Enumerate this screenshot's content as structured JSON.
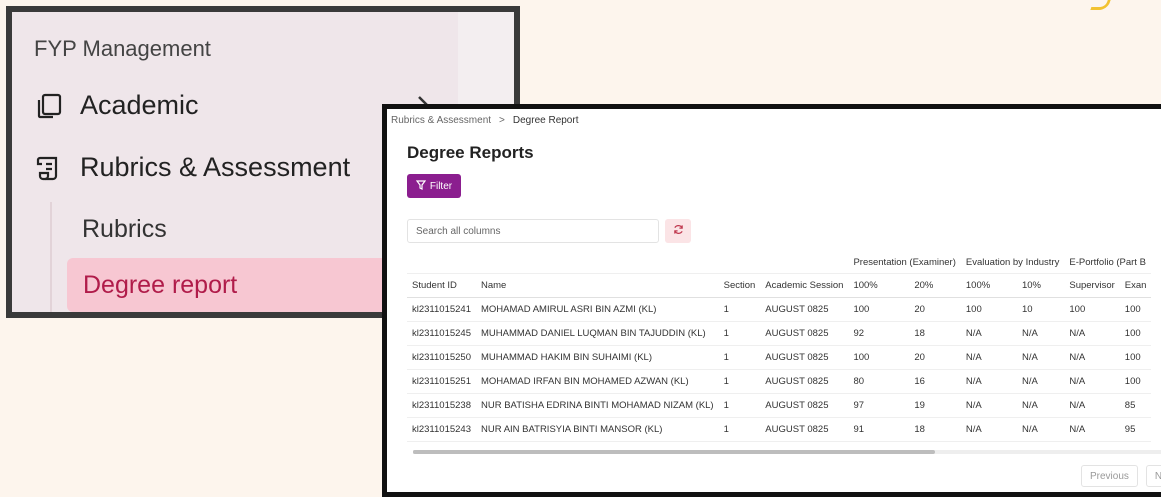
{
  "sidebar": {
    "section_title": "FYP Management",
    "items": [
      {
        "label": "Academic",
        "icon": "copy-icon"
      },
      {
        "label": "Rubrics & Assessment",
        "icon": "scroll-icon"
      }
    ],
    "sub_items": [
      {
        "label": "Rubrics"
      },
      {
        "label": "Degree report",
        "active": true
      }
    ]
  },
  "breadcrumb": {
    "parent": "Rubrics & Assessment",
    "separator": ">",
    "current": "Degree Report"
  },
  "page": {
    "title": "Degree Reports"
  },
  "toolbar": {
    "filter_label": "Filter",
    "search_placeholder": "Search all columns"
  },
  "table": {
    "group_headers": [
      "",
      "",
      "",
      "",
      "Presentation (Examiner)",
      "Evaluation by Industry",
      "E-Portfolio (Part B"
    ],
    "columns": [
      "Student ID",
      "Name",
      "Section",
      "Academic Session",
      "100%",
      "20%",
      "100%",
      "10%",
      "Supervisor",
      "Exan"
    ],
    "rows": [
      [
        "kl2311015241",
        "MOHAMAD AMIRUL ASRI BIN AZMI (KL)",
        "1",
        "AUGUST 0825",
        "100",
        "20",
        "100",
        "10",
        "100",
        "100"
      ],
      [
        "kl2311015245",
        "MUHAMMAD DANIEL LUQMAN BIN TAJUDDIN (KL)",
        "1",
        "AUGUST 0825",
        "92",
        "18",
        "N/A",
        "N/A",
        "N/A",
        "100"
      ],
      [
        "kl2311015250",
        "MUHAMMAD HAKIM BIN SUHAIMI (KL)",
        "1",
        "AUGUST 0825",
        "100",
        "20",
        "N/A",
        "N/A",
        "N/A",
        "100"
      ],
      [
        "kl2311015251",
        "MOHAMAD IRFAN BIN MOHAMED AZWAN (KL)",
        "1",
        "AUGUST 0825",
        "80",
        "16",
        "N/A",
        "N/A",
        "N/A",
        "100"
      ],
      [
        "kl2311015238",
        "NUR BATISHA EDRINA BINTI MOHAMAD NIZAM (KL)",
        "1",
        "AUGUST 0825",
        "97",
        "19",
        "N/A",
        "N/A",
        "N/A",
        "85"
      ],
      [
        "kl2311015243",
        "NUR AIN BATRISYIA BINTI MANSOR (KL)",
        "1",
        "AUGUST 0825",
        "91",
        "18",
        "N/A",
        "N/A",
        "N/A",
        "95"
      ]
    ]
  },
  "pagination": {
    "previous_label": "Previous",
    "next_label": "Ne"
  },
  "colors": {
    "accent": "#8b1e8f",
    "active_bg": "#f7c7d2",
    "active_text": "#b01c4a"
  }
}
